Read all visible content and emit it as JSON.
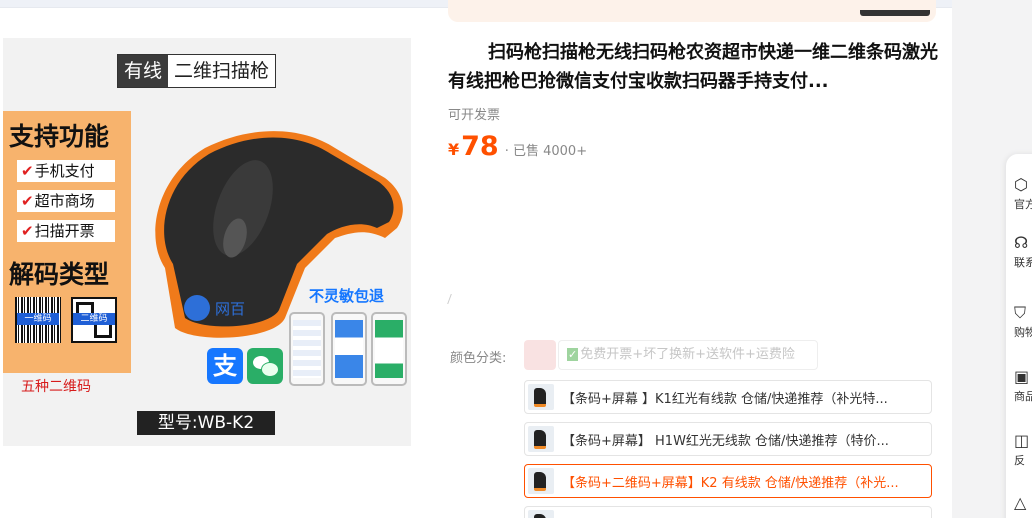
{
  "product": {
    "title": "扫码枪扫描枪无线扫码枪农资超市快递一维二维条码激光有线把枪巴抢微信支付宝收款扫码器手持支付...",
    "invoice": "可开发票",
    "currency": "¥",
    "price": "78",
    "sold": "· 已售 4000+"
  },
  "image": {
    "header_a": "有线",
    "header_b": "二维扫描枪",
    "feature_title": "支持功能",
    "features": [
      "手机支付",
      "超市商场",
      "扫描开票"
    ],
    "check_mark": "✔",
    "decode_title": "解码类型",
    "barcode_tag": "一维码",
    "qrcode_tag": "二维码",
    "five_codes": "五种二维码",
    "no_sensitive": "不灵敏包退",
    "model": "型号:WB-K2",
    "brand": "网百",
    "alipay_glyph": "支"
  },
  "sku": {
    "label": "颜色分类:",
    "disabled_option": "免费开票+坏了换新+送软件+运费险",
    "options": [
      {
        "text": "【条码+屏幕 】K1红光有线款 仓储/快递推荐（补光特...",
        "selected": false
      },
      {
        "text": "【条码+屏幕】 H1W红光无线款 仓储/快递推荐（特价...",
        "selected": false
      },
      {
        "text": "【条码+二维码+屏幕】K2 有线款 仓储/快递推荐（补光...",
        "selected": true
      },
      {
        "text": "",
        "selected": false
      }
    ]
  },
  "sidebar": {
    "items": [
      {
        "icon": "official-icon",
        "glyph": "⬡",
        "label": "官方"
      },
      {
        "icon": "contact-icon",
        "glyph": "☊",
        "label": "联系"
      },
      {
        "icon": "cart-icon",
        "glyph": "⛉",
        "label": "购物"
      },
      {
        "icon": "product-icon",
        "glyph": "▣",
        "label": "商品"
      },
      {
        "icon": "feedback-icon",
        "glyph": "◫",
        "label": "反"
      },
      {
        "icon": "top-icon",
        "glyph": "△",
        "label": ""
      }
    ]
  },
  "colors": {
    "accent": "#ff5000",
    "selected_border": "#ff5000",
    "feature_panel": "#f7b36d",
    "blue_text": "#1677ff"
  }
}
